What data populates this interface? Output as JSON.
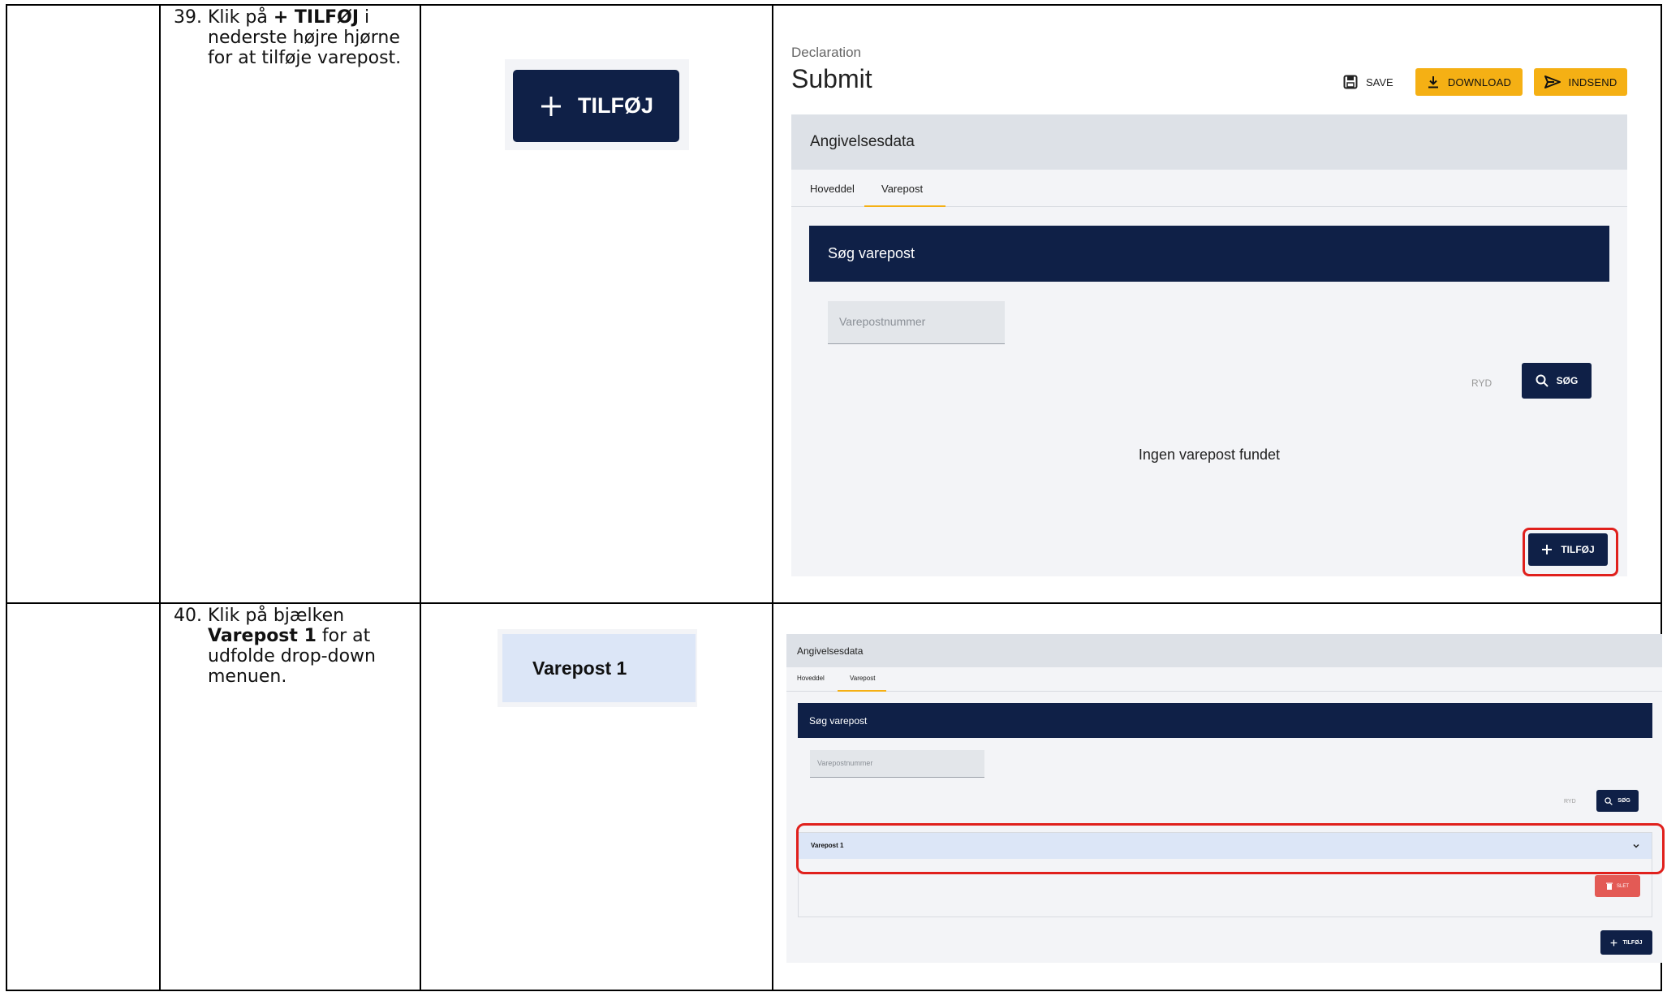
{
  "rows": [
    {
      "number": "39.",
      "instruction_lines": [
        [
          {
            "t": "Klik på ",
            "b": false
          },
          {
            "t": "+ TILFØJ",
            "b": true
          },
          {
            "t": " i",
            "b": false
          }
        ],
        [
          {
            "t": "nederste højre hjørne",
            "b": false
          }
        ],
        [
          {
            "t": "for at tilføje varepost.",
            "b": false
          }
        ]
      ],
      "zoom_label": "TILFØJ",
      "zoom_icon": "plus-icon",
      "screen": {
        "breadcrumb": "Declaration",
        "title": "Submit",
        "save_label": "SAVE",
        "download_label": "DOWNLOAD",
        "indsend_label": "INDSEND",
        "panel_title": "Angivelsesdata",
        "tabs": [
          "Hoveddel",
          "Varepost"
        ],
        "active_tab": "Varepost",
        "search_header": "Søg varepost",
        "input_placeholder": "Varepostnummer",
        "clear_label": "RYD",
        "search_label": "SØG",
        "empty_message": "Ingen varepost fundet",
        "add_label": "TILFØJ"
      }
    },
    {
      "number": "40.",
      "instruction_lines": [
        [
          {
            "t": "Klik på bjælken",
            "b": false
          }
        ],
        [
          {
            "t": "Varepost 1",
            "b": true
          },
          {
            "t": " for at",
            "b": false
          }
        ],
        [
          {
            "t": "udfolde drop-down",
            "b": false
          }
        ],
        [
          {
            "t": "menuen.",
            "b": false
          }
        ]
      ],
      "zoom_label": "Varepost 1",
      "screen": {
        "panel_title": "Angivelsesdata",
        "tabs": [
          "Hoveddel",
          "Varepost"
        ],
        "active_tab": "Varepost",
        "search_header": "Søg varepost",
        "input_placeholder": "Varepostnummer",
        "clear_label": "RYD",
        "search_label": "SØG",
        "accordion_label": "Varepost 1",
        "delete_label": "SLET",
        "add_label": "TILFØJ"
      }
    }
  ],
  "colors": {
    "navy": "#0f2047",
    "yellow": "#f5b014",
    "highlight_red": "#e0201c",
    "delete_red": "#e35a55",
    "accordion_blue": "#dce6f7",
    "tab_underline": "#f5b014"
  }
}
